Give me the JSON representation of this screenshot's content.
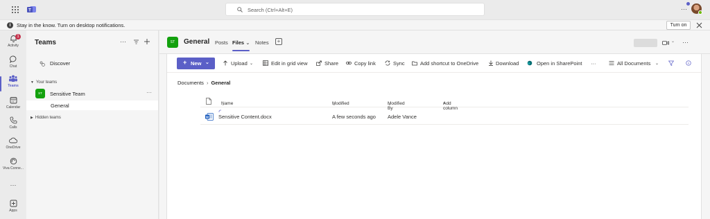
{
  "titlebar": {
    "search_placeholder": "Search (Ctrl+Alt+E)",
    "more": "···"
  },
  "banner": {
    "text": "Stay in the know. Turn on desktop notifications.",
    "turn_on": "Turn on"
  },
  "appbar": {
    "items": [
      {
        "label": "Activity",
        "badge": "1"
      },
      {
        "label": "Chat"
      },
      {
        "label": "Teams"
      },
      {
        "label": "Calendar"
      },
      {
        "label": "Calls"
      },
      {
        "label": "OneDrive"
      },
      {
        "label": "Viva Conne..."
      },
      {
        "label": "···"
      },
      {
        "label": "Apps"
      }
    ]
  },
  "teams_pane": {
    "title": "Teams",
    "more": "···",
    "discover": "Discover",
    "your_teams": "Your teams",
    "team_avatar": "ST",
    "team_name": "Sensitive Team",
    "team_more": "···",
    "channel": "General",
    "hidden_teams": "Hidden teams"
  },
  "channel_header": {
    "avatar": "ST",
    "name": "General",
    "tabs": [
      "Posts",
      "Files",
      "Notes"
    ],
    "files_caret": "⌄",
    "more": "···"
  },
  "toolbar": {
    "new_label": "New",
    "upload": "Upload",
    "edit_grid": "Edit in grid view",
    "share": "Share",
    "copy_link": "Copy link",
    "sync": "Sync",
    "add_shortcut": "Add shortcut to OneDrive",
    "download": "Download",
    "open_sharepoint": "Open in SharePoint",
    "more": "···",
    "all_documents": "All Documents"
  },
  "breadcrumb": {
    "root": "Documents",
    "current": "General"
  },
  "columns": {
    "name": "Name",
    "modified": "Modified",
    "modified_by": "Modified By",
    "add_column": "Add column"
  },
  "files": [
    {
      "name": "Sensitive Content.docx",
      "modified": "A few seconds ago",
      "modified_by": "Adele Vance"
    }
  ],
  "colors": {
    "accent": "#5b5fc7",
    "team_green": "#13a10e",
    "word_blue": "#185abd"
  }
}
